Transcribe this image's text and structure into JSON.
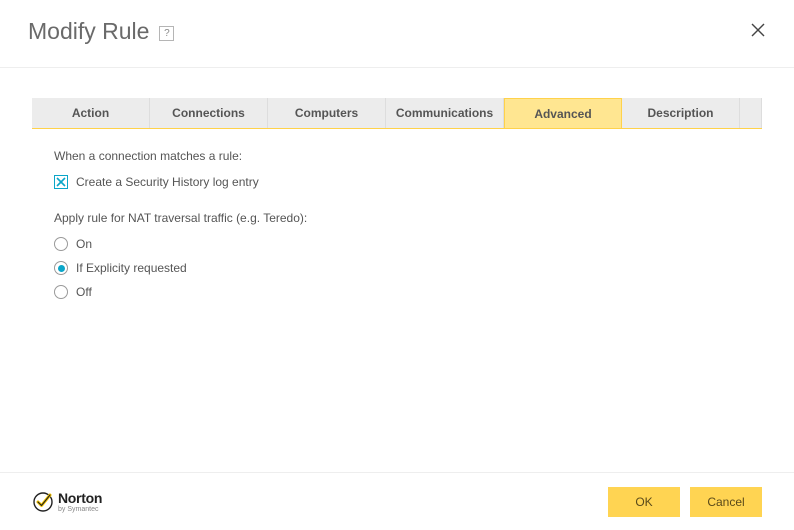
{
  "header": {
    "title": "Modify Rule",
    "help_glyph": "?"
  },
  "tabs": [
    {
      "label": "Action",
      "active": false
    },
    {
      "label": "Connections",
      "active": false
    },
    {
      "label": "Computers",
      "active": false
    },
    {
      "label": "Communications",
      "active": false
    },
    {
      "label": "Advanced",
      "active": true
    },
    {
      "label": "Description",
      "active": false
    }
  ],
  "panel": {
    "section1_label": "When a connection matches a rule:",
    "checkbox_label": "Create a Security History log entry",
    "checkbox_checked": true,
    "section2_label": "Apply rule for NAT traversal traffic (e.g. Teredo):",
    "radio_options": [
      {
        "label": "On",
        "selected": false
      },
      {
        "label": "If Explicity requested",
        "selected": true
      },
      {
        "label": "Off",
        "selected": false
      }
    ]
  },
  "footer": {
    "logo_name": "Norton",
    "logo_sub": "by Symantec",
    "ok_label": "OK",
    "cancel_label": "Cancel"
  }
}
